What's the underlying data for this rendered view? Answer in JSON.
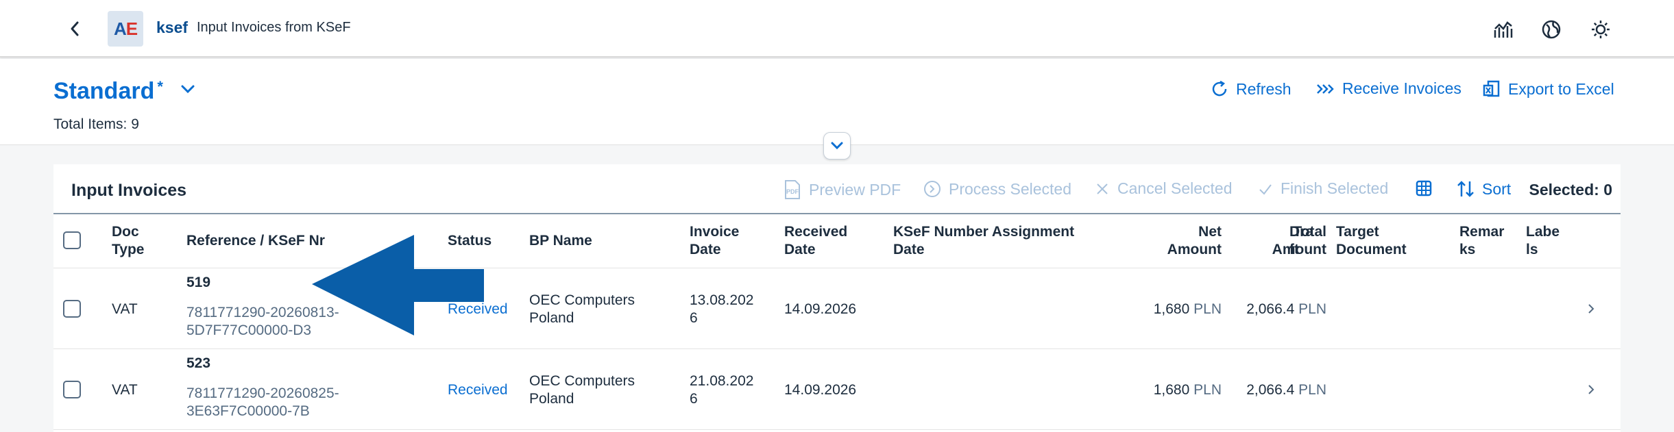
{
  "shell": {
    "app_name": "ksef",
    "app_title": "Input Invoices from KSeF",
    "logo_a": "A",
    "logo_e": "E"
  },
  "header": {
    "variant_name": "Standard",
    "variant_modified": "*",
    "total_items": "Total Items: 9",
    "actions": {
      "refresh": "Refresh",
      "receive": "Receive Invoices",
      "export": "Export to Excel"
    }
  },
  "table": {
    "title": "Input Invoices",
    "toolbar": {
      "preview_pdf": "Preview PDF",
      "process_selected": "Process Selected",
      "cancel_selected": "Cancel Selected",
      "finish_selected": "Finish Selected",
      "sort": "Sort",
      "selected": "Selected: 0"
    },
    "columns": {
      "doc_type": [
        "Doc",
        "Type"
      ],
      "reference": "Reference / KSeF Nr",
      "status": "Status",
      "bp_name": "BP Name",
      "invoice_date": [
        "Invoice",
        "Date"
      ],
      "received_date": [
        "Received",
        "Date"
      ],
      "ksef_assignment": [
        "KSeF Number Assignment",
        "Date"
      ],
      "net_amount": [
        "Net",
        "Amount"
      ],
      "total_amount": [
        "Total",
        "Amount"
      ],
      "draft": [
        "Dra",
        "ft"
      ],
      "target_document": [
        "Target",
        "Document"
      ],
      "remarks": [
        "Remar",
        "ks"
      ],
      "labels": [
        "Labe",
        "ls"
      ]
    },
    "rows": [
      {
        "doc_type": "VAT",
        "ref_number": "519",
        "ksef_nr_1": "7811771290-20260813-",
        "ksef_nr_2": "5D7F77C00000-D3",
        "status": "Received",
        "bp_name_1": "OEC Computers",
        "bp_name_2": "Poland",
        "invoice_date_1": "13.08.202",
        "invoice_date_2": "6",
        "received_date": "14.09.2026",
        "net_amount": "1,680",
        "net_currency": "PLN",
        "total_amount": "2,066.4",
        "total_currency": "PLN"
      },
      {
        "doc_type": "VAT",
        "ref_number": "523",
        "ksef_nr_1": "7811771290-20260825-",
        "ksef_nr_2": "3E63F7C00000-7B",
        "status": "Received",
        "bp_name_1": "OEC Computers",
        "bp_name_2": "Poland",
        "invoice_date_1": "21.08.202",
        "invoice_date_2": "6",
        "received_date": "14.09.2026",
        "net_amount": "1,680",
        "net_currency": "PLN",
        "total_amount": "2,066.4",
        "total_currency": "PLN"
      }
    ]
  },
  "colors": {
    "accent": "#0a6ed1",
    "annotation_arrow": "#0a5ea8",
    "disabled": "#a9c2dc"
  }
}
